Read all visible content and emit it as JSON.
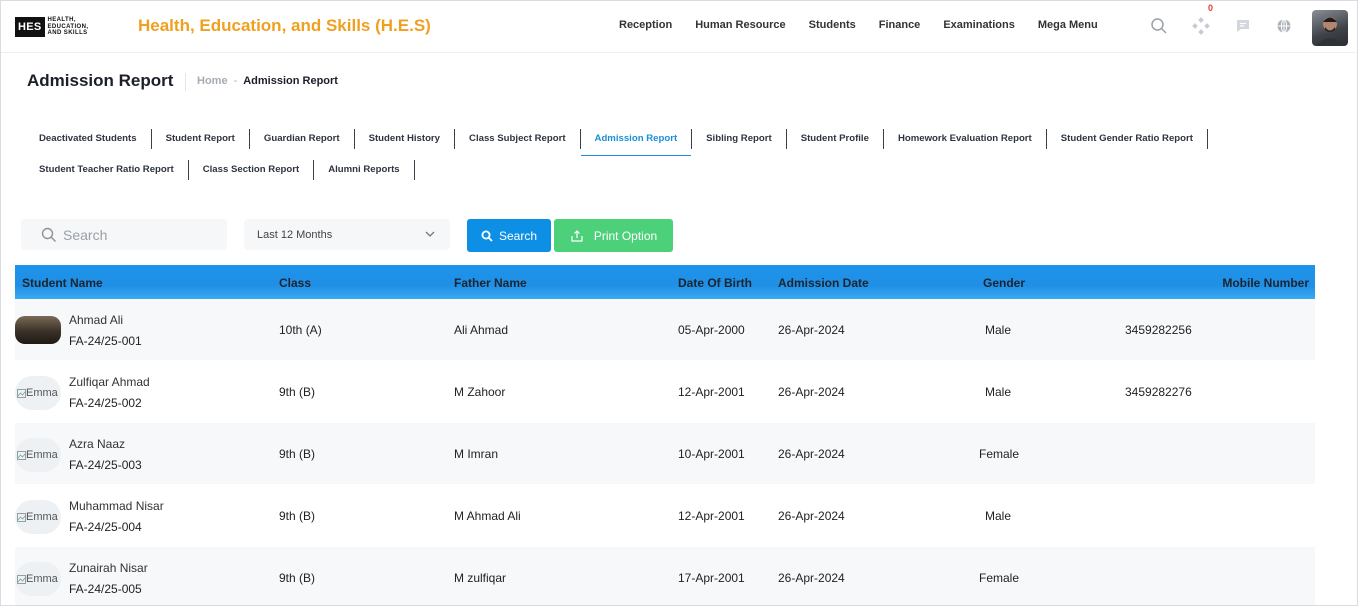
{
  "brand": {
    "logo_mark": "HES",
    "logo_words": [
      "HEALTH,",
      "EDUCATION,",
      "AND SKILLS"
    ],
    "app_title": "Health, Education, and Skills (H.E.S)"
  },
  "nav": {
    "items": [
      "Reception",
      "Human Resource",
      "Students",
      "Finance",
      "Examinations",
      "Mega Menu"
    ]
  },
  "header_icons": {
    "search": "search-icon",
    "apps": "apps-icon",
    "messages": "message-icon",
    "language": "globe-icon",
    "notification_count": "0"
  },
  "page": {
    "title": "Admission Report",
    "breadcrumb_home": "Home",
    "breadcrumb_sep": "-",
    "breadcrumb_current": "Admission Report"
  },
  "tabs": {
    "row1": [
      "Deactivated Students",
      "Student Report",
      "Guardian Report",
      "Student History",
      "Class Subject Report",
      "Admission Report",
      "Sibling Report",
      "Student Profile",
      "Homework Evaluation Report",
      "Student Gender Ratio Report"
    ],
    "row2": [
      "Student Teacher Ratio Report",
      "Class Section Report",
      "Alumni Reports"
    ],
    "active": "Admission Report"
  },
  "toolbar": {
    "search_placeholder": "Search",
    "period_value": "Last 12 Months",
    "search_button": "Search",
    "print_button": "Print Option"
  },
  "colors": {
    "brand_title": "#f0a020",
    "primary": "#0d8fe6",
    "success": "#4cd17a",
    "active_tab": "#1a8fd9"
  },
  "table": {
    "columns": [
      "Student Name",
      "Class",
      "Father Name",
      "Date Of Birth",
      "Admission Date",
      "Gender",
      "Mobile Number"
    ],
    "rows": [
      {
        "photo": "photo",
        "alt": "",
        "name": "Ahmad Ali",
        "roll": "FA-24/25-001",
        "class": "10th (A)",
        "father": "Ali Ahmad",
        "dob": "05-Apr-2000",
        "admission": "26-Apr-2024",
        "gender": "Male",
        "mobile": "3459282256"
      },
      {
        "photo": "broken",
        "alt": "Emma",
        "name": "Zulfiqar Ahmad",
        "roll": "FA-24/25-002",
        "class": "9th (B)",
        "father": "M Zahoor",
        "dob": "12-Apr-2001",
        "admission": "26-Apr-2024",
        "gender": "Male",
        "mobile": "3459282276"
      },
      {
        "photo": "broken",
        "alt": "Emma",
        "name": "Azra Naaz",
        "roll": "FA-24/25-003",
        "class": "9th (B)",
        "father": "M Imran",
        "dob": "10-Apr-2001",
        "admission": "26-Apr-2024",
        "gender": "Female",
        "mobile": ""
      },
      {
        "photo": "broken",
        "alt": "Emma",
        "name": "Muhammad Nisar",
        "roll": "FA-24/25-004",
        "class": "9th (B)",
        "father": "M Ahmad Ali",
        "dob": "12-Apr-2001",
        "admission": "26-Apr-2024",
        "gender": "Male",
        "mobile": ""
      },
      {
        "photo": "broken",
        "alt": "Emma",
        "name": "Zunairah Nisar",
        "roll": "FA-24/25-005",
        "class": "9th (B)",
        "father": "M zulfiqar",
        "dob": "17-Apr-2001",
        "admission": "26-Apr-2024",
        "gender": "Female",
        "mobile": ""
      }
    ]
  }
}
